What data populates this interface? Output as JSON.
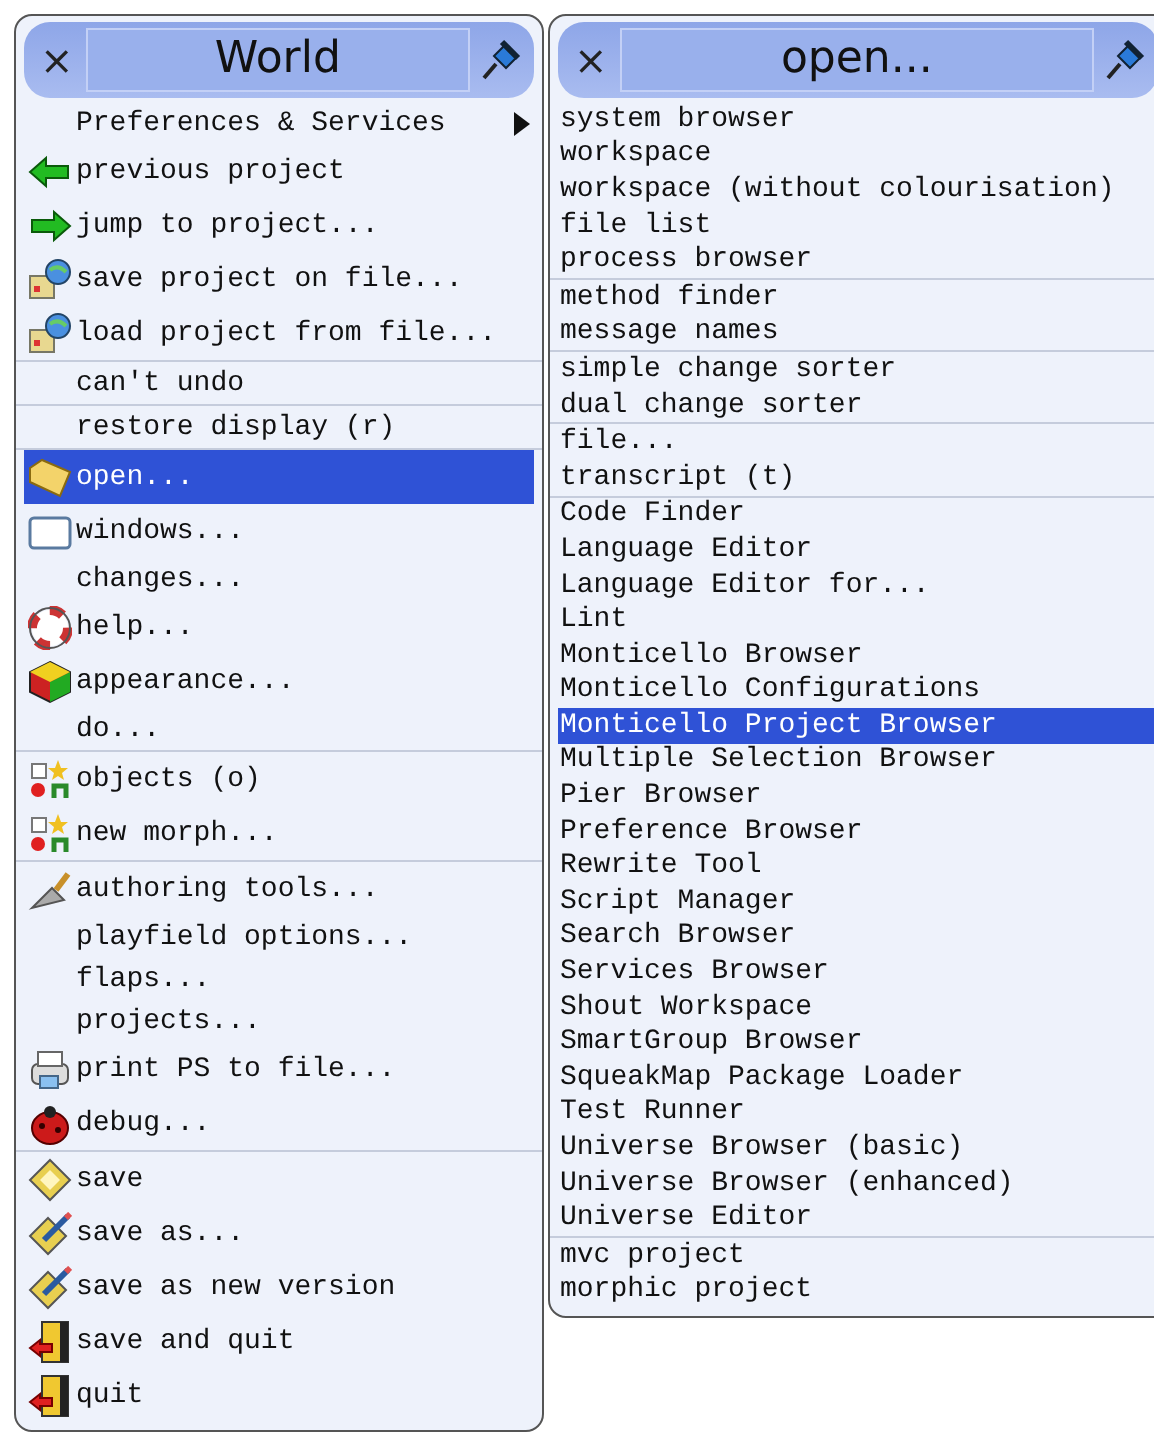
{
  "menus": [
    {
      "title": "World",
      "close": "×",
      "groups": [
        [
          {
            "label": "Preferences & Services",
            "kind": "text",
            "selected": false,
            "submenu": true
          },
          {
            "label": "previous project",
            "kind": "back",
            "selected": false,
            "submenu": false
          },
          {
            "label": "jump to project...",
            "kind": "forward",
            "selected": false,
            "submenu": false
          },
          {
            "label": "save project on file...",
            "kind": "save-project",
            "selected": false,
            "submenu": false
          },
          {
            "label": "load project from file...",
            "kind": "load-project",
            "selected": false,
            "submenu": false
          }
        ],
        [
          {
            "label": "can't undo",
            "kind": "text",
            "selected": false,
            "submenu": false
          }
        ],
        [
          {
            "label": "restore display (r)",
            "kind": "text",
            "selected": false,
            "submenu": false
          }
        ],
        [
          {
            "label": "open...",
            "kind": "folder",
            "selected": true,
            "submenu": false
          },
          {
            "label": "windows...",
            "kind": "window",
            "selected": false,
            "submenu": false
          },
          {
            "label": "changes...",
            "kind": "text",
            "selected": false,
            "submenu": false
          },
          {
            "label": "help...",
            "kind": "help",
            "selected": false,
            "submenu": false
          },
          {
            "label": "appearance...",
            "kind": "appearance",
            "selected": false,
            "submenu": false
          },
          {
            "label": "do...",
            "kind": "text",
            "selected": false,
            "submenu": false
          }
        ],
        [
          {
            "label": "objects (o)",
            "kind": "objects",
            "selected": false,
            "submenu": false
          },
          {
            "label": "new morph...",
            "kind": "objects",
            "selected": false,
            "submenu": false
          }
        ],
        [
          {
            "label": "authoring tools...",
            "kind": "authoring",
            "selected": false,
            "submenu": false
          },
          {
            "label": "playfield options...",
            "kind": "text",
            "selected": false,
            "submenu": false
          },
          {
            "label": "flaps...",
            "kind": "text",
            "selected": false,
            "submenu": false
          },
          {
            "label": "projects...",
            "kind": "text",
            "selected": false,
            "submenu": false
          },
          {
            "label": "print PS to file...",
            "kind": "print",
            "selected": false,
            "submenu": false
          },
          {
            "label": "debug...",
            "kind": "debug",
            "selected": false,
            "submenu": false
          }
        ],
        [
          {
            "label": "save",
            "kind": "save",
            "selected": false,
            "submenu": false
          },
          {
            "label": "save as...",
            "kind": "save-as",
            "selected": false,
            "submenu": false
          },
          {
            "label": "save as new version",
            "kind": "save-as",
            "selected": false,
            "submenu": false
          },
          {
            "label": "save and quit",
            "kind": "quit",
            "selected": false,
            "submenu": false
          },
          {
            "label": "quit",
            "kind": "quit",
            "selected": false,
            "submenu": false
          }
        ]
      ]
    },
    {
      "title": "open...",
      "close": "×",
      "groups": [
        [
          {
            "label": "system browser",
            "selected": false
          },
          {
            "label": "workspace",
            "selected": false
          },
          {
            "label": "workspace (without colourisation)",
            "selected": false
          },
          {
            "label": "file list",
            "selected": false
          },
          {
            "label": "process browser",
            "selected": false
          }
        ],
        [
          {
            "label": "method finder",
            "selected": false
          },
          {
            "label": "message names",
            "selected": false
          }
        ],
        [
          {
            "label": "simple change sorter",
            "selected": false
          },
          {
            "label": "dual change sorter",
            "selected": false
          }
        ],
        [
          {
            "label": "file...",
            "selected": false
          },
          {
            "label": "transcript (t)",
            "selected": false
          }
        ],
        [
          {
            "label": "Code Finder",
            "selected": false
          },
          {
            "label": "Language Editor",
            "selected": false
          },
          {
            "label": "Language Editor for...",
            "selected": false
          },
          {
            "label": "Lint",
            "selected": false
          },
          {
            "label": "Monticello Browser",
            "selected": false
          },
          {
            "label": "Monticello Configurations",
            "selected": false
          },
          {
            "label": "Monticello Project Browser",
            "selected": true
          },
          {
            "label": "Multiple Selection Browser",
            "selected": false
          },
          {
            "label": "Pier Browser",
            "selected": false
          },
          {
            "label": "Preference Browser",
            "selected": false
          },
          {
            "label": "Rewrite Tool",
            "selected": false
          },
          {
            "label": "Script Manager",
            "selected": false
          },
          {
            "label": "Search Browser",
            "selected": false
          },
          {
            "label": "Services Browser",
            "selected": false
          },
          {
            "label": "Shout Workspace",
            "selected": false
          },
          {
            "label": "SmartGroup Browser",
            "selected": false
          },
          {
            "label": "SqueakMap Package Loader",
            "selected": false
          },
          {
            "label": "Test Runner",
            "selected": false
          },
          {
            "label": "Universe Browser (basic)",
            "selected": false
          },
          {
            "label": "Universe Browser (enhanced)",
            "selected": false
          },
          {
            "label": "Universe Editor",
            "selected": false
          }
        ],
        [
          {
            "label": "mvc project",
            "selected": false
          },
          {
            "label": "morphic project",
            "selected": false
          }
        ]
      ]
    }
  ]
}
